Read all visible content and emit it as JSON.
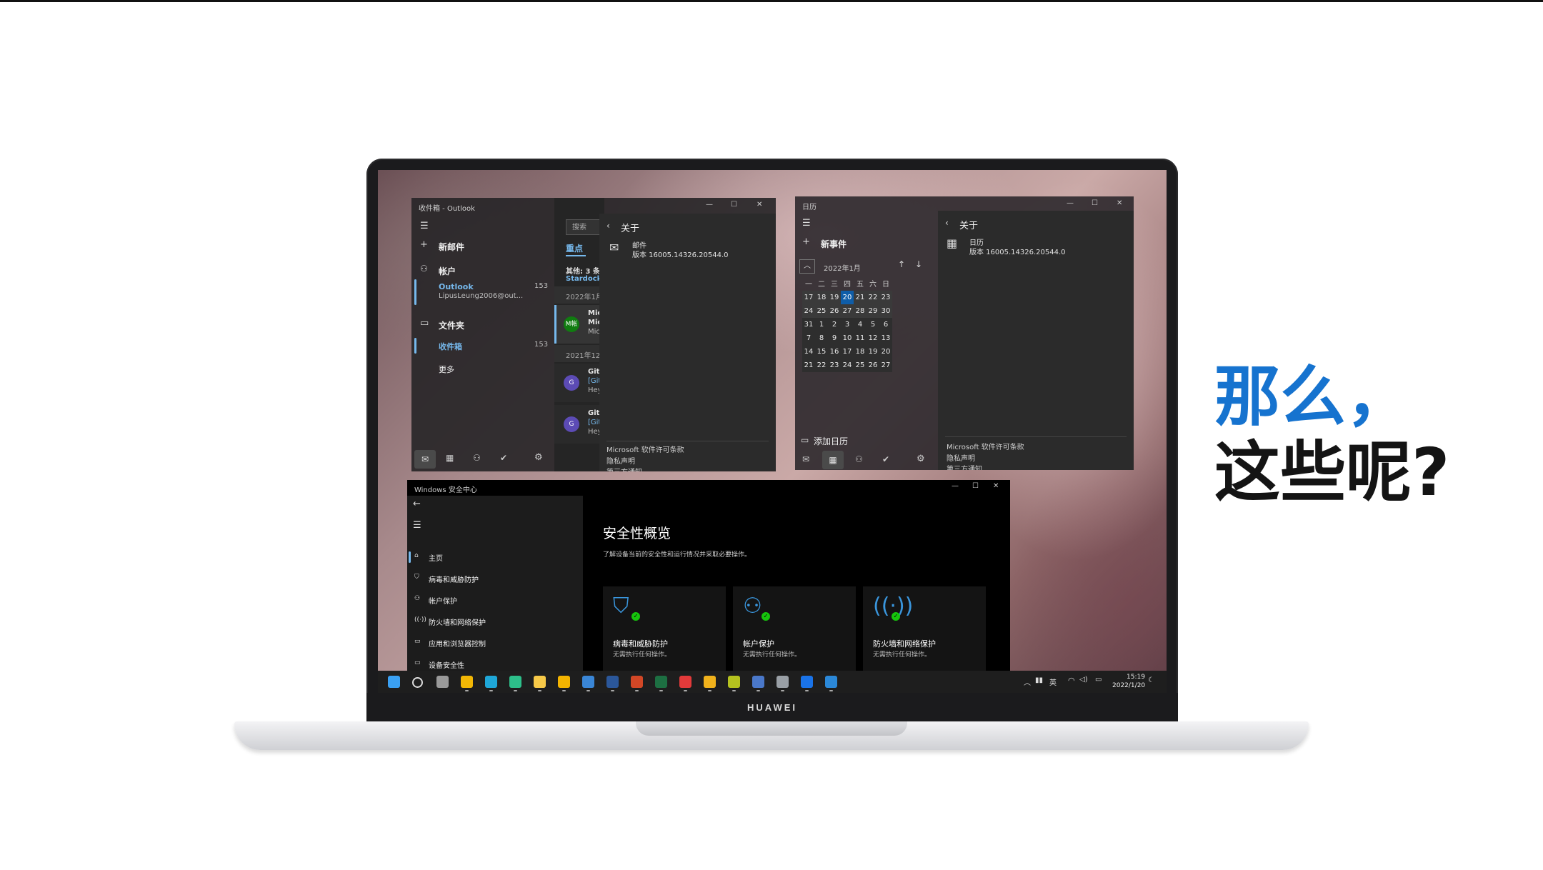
{
  "slogan": {
    "line1": "那么，",
    "line2": "这些呢?"
  },
  "laptop": {
    "brand": "HUAWEI"
  },
  "mail": {
    "title": "收件箱 - Outlook",
    "new_mail": "新邮件",
    "accounts": "帐户",
    "account_name": "Outlook",
    "account_count": "153",
    "account_email": "LipusLeung2006@out...",
    "folders": "文件夹",
    "inbox": "收件箱",
    "inbox_count": "153",
    "more": "更多",
    "search_placeholder": "搜索",
    "tab_focused": "重点",
    "other_line1": "其他: 3 条",
    "other_line2": "Stardock",
    "date_group1": "2022年1月",
    "date_group2": "2021年12",
    "row1_avatar": "M帐",
    "row1_l1": "Mic",
    "row1_l2": "Mic",
    "row1_l3": "Mic",
    "row2_avatar": "G",
    "row2_l1": "Git",
    "row2_l2": "[Git",
    "row2_l3": "Hey",
    "row3_avatar": "G",
    "row3_l1": "Git",
    "row3_l2": "[Git",
    "row3_l3": "Hey",
    "about_title": "关于",
    "app_name": "邮件",
    "version": "版本 16005.14326.20544.0",
    "link_license": "Microsoft 软件许可条款",
    "link_privacy": "隐私声明",
    "link_third": "第三方通知"
  },
  "calendar": {
    "title": "日历",
    "new_event": "新事件",
    "month": "2022年1月",
    "weekdays": [
      "一",
      "二",
      "三",
      "四",
      "五",
      "六",
      "日"
    ],
    "weeks": [
      [
        "17",
        "18",
        "19",
        "20",
        "21",
        "22",
        "23"
      ],
      [
        "24",
        "25",
        "26",
        "27",
        "28",
        "29",
        "30"
      ],
      [
        "31",
        "1",
        "2",
        "3",
        "4",
        "5",
        "6"
      ],
      [
        "7",
        "8",
        "9",
        "10",
        "11",
        "12",
        "13"
      ],
      [
        "14",
        "15",
        "16",
        "17",
        "18",
        "19",
        "20"
      ],
      [
        "21",
        "22",
        "23",
        "24",
        "25",
        "26",
        "27"
      ]
    ],
    "today": "20",
    "add_calendar": "添加日历",
    "about_title": "关于",
    "app_name": "日历",
    "version": "版本 16005.14326.20544.0",
    "link_license": "Microsoft 软件许可条款",
    "link_privacy": "隐私声明",
    "link_third": "第三方通知"
  },
  "security": {
    "title": "Windows 安全中心",
    "nav": [
      "主页",
      "病毒和威胁防护",
      "帐户保护",
      "防火墙和网络保护",
      "应用和浏览器控制",
      "设备安全性"
    ],
    "heading": "安全性概览",
    "subheading": "了解设备当前的安全性和运行情况并采取必要操作。",
    "cards": [
      {
        "title": "病毒和威胁防护",
        "status": "无需执行任何操作。"
      },
      {
        "title": "帐户保护",
        "status": "无需执行任何操作。"
      },
      {
        "title": "防火墙和网络保护",
        "status": "无需执行任何操作。"
      }
    ]
  },
  "taskbar": {
    "tray_lang": "英",
    "time": "15:19",
    "date": "2022/1/20"
  },
  "colors": {
    "accent": "#1673cf",
    "win_accent": "#76b9ed",
    "ok_green": "#16c60c"
  }
}
